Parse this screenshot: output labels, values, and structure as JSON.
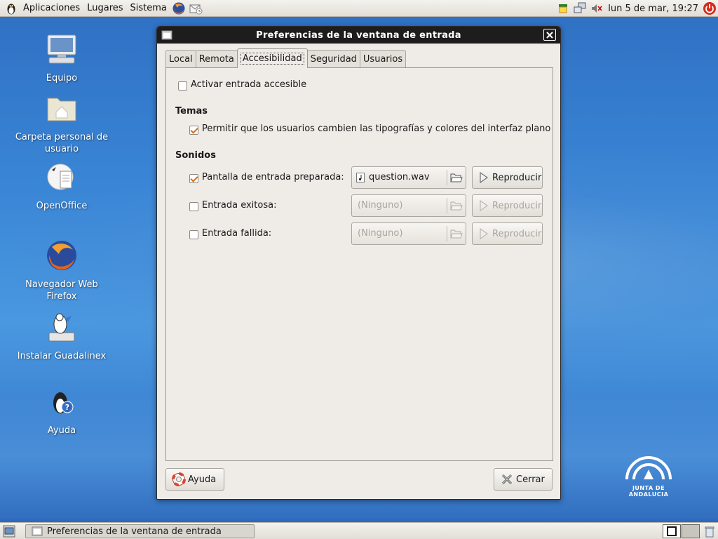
{
  "top_panel": {
    "menus": [
      "Aplicaciones",
      "Lugares",
      "Sistema"
    ],
    "clock": "lun  5 de mar, 19:27"
  },
  "desktop": {
    "icons": [
      {
        "label": "Equipo",
        "icon": "computer-icon"
      },
      {
        "label": "Carpeta personal de usuario",
        "icon": "home-folder-icon"
      },
      {
        "label": "OpenOffice",
        "icon": "openoffice-icon"
      },
      {
        "label": "Navegador Web Firefox",
        "icon": "firefox-icon"
      },
      {
        "label": "Instalar Guadalinex",
        "icon": "installer-icon"
      },
      {
        "label": "Ayuda",
        "icon": "help-icon"
      }
    ],
    "logo_text": "JUNTA DE ANDALUCIA"
  },
  "window": {
    "title": "Preferencias de la ventana de entrada",
    "tabs": [
      "Local",
      "Remota",
      "Accesibilidad",
      "Seguridad",
      "Usuarios"
    ],
    "active_tab": "Accesibilidad",
    "accessible_login": {
      "label": "Activar entrada accesible",
      "checked": false
    },
    "themes": {
      "heading": "Temas",
      "allow_fonts": {
        "label": "Permitir que los usuarios cambien las tipografías y colores del interfaz plano",
        "checked": true
      }
    },
    "sounds": {
      "heading": "Sonidos",
      "rows": [
        {
          "label": "Pantalla de entrada preparada:",
          "checked": true,
          "file": "question.wav",
          "enabled": true,
          "play": "Reproducir"
        },
        {
          "label": "Entrada exitosa:",
          "checked": false,
          "file": "(Ninguno)",
          "enabled": false,
          "play": "Reproducir"
        },
        {
          "label": "Entrada fallida:",
          "checked": false,
          "file": "(Ninguno)",
          "enabled": false,
          "play": "Reproducir"
        }
      ]
    },
    "help_button": "Ayuda",
    "close_button": "Cerrar"
  },
  "bottom_panel": {
    "task_label": "Preferencias de la ventana de entrada"
  },
  "colors": {
    "desktop_blue": "#3a86d6",
    "check_orange": "#d06f1c",
    "titlebar": "#1d1d1d",
    "window_bg": "#efebe7"
  }
}
